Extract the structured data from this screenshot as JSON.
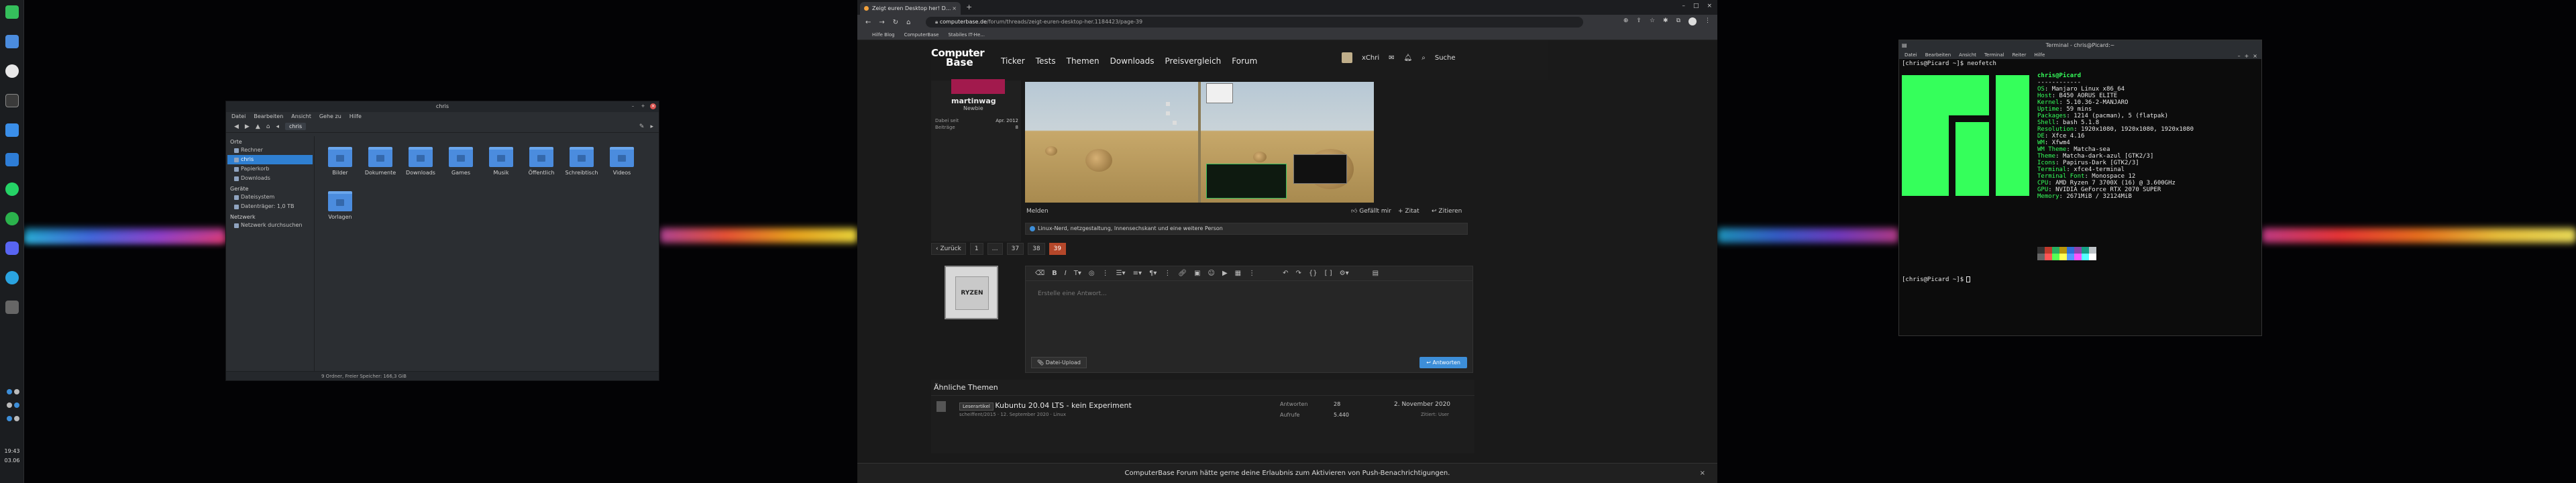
{
  "panel": {
    "clock_time": "19:43",
    "clock_date": "03.06",
    "launcher_icons": [
      "manjaro-icon",
      "files-icon",
      "browser-icon",
      "terminal-icon",
      "mail-icon",
      "office-icon",
      "chat-icon",
      "whatsapp-icon",
      "discord-icon",
      "telegram-icon",
      "settings-icon"
    ]
  },
  "file_manager": {
    "title": "chris",
    "menu": [
      "Datei",
      "Bearbeiten",
      "Ansicht",
      "Gehe zu",
      "Hilfe"
    ],
    "path": "chris",
    "sidebar": {
      "sections": [
        {
          "heading": "Orte",
          "items": [
            "Rechner",
            "chris",
            "Papierkorb",
            "Downloads"
          ]
        },
        {
          "heading": "Geräte",
          "items": [
            "Dateisystem",
            "Datenträger: 1,0 TB"
          ]
        },
        {
          "heading": "Netzwerk",
          "items": [
            "Netzwerk durchsuchen"
          ]
        }
      ],
      "selected": "chris"
    },
    "folders": [
      "Bilder",
      "Dokumente",
      "Downloads",
      "Games",
      "Musik",
      "Öffentlich",
      "Schreibtisch",
      "Videos",
      "Vorlagen"
    ],
    "status": "9 Ordner, Freier Speicher: 166,3 GiB"
  },
  "browser": {
    "tab_title": "Zeigt euren Desktop her! D...",
    "url_domain": "computerbase.de",
    "url_path": "/forum/threads/zeigt-euren-desktop-her.1184423/page-39",
    "bookmarks": [
      "Hilfe Blog",
      "ComputerBase",
      "Stabiles IT-He..."
    ],
    "site": {
      "logo_line1": "Computer",
      "logo_line2": "Base",
      "nav": [
        "Ticker",
        "Tests",
        "Themen",
        "Downloads",
        "Preisvergleich",
        "Forum"
      ],
      "user_name": "xChri",
      "search_label": "Suche"
    },
    "post": {
      "author": "martinwag",
      "rank": "Newbie",
      "joined_label": "Dabei seit",
      "joined_value": "Apr. 2012",
      "posts_label": "Beiträge",
      "posts_value": "8",
      "report_label": "Melden",
      "like_label": "Gefällt mir",
      "quote_label": "Zitat",
      "cite_label": "Zitieren",
      "reactions": "Linux-Nerd, netzgestaltung, Innensechskant und eine weitere Person"
    },
    "pagination": [
      "‹ Zurück",
      "1",
      "…",
      "37",
      "38",
      "39"
    ],
    "current_page": "39",
    "editor": {
      "avatar_text": "RYZEN",
      "placeholder": "Erstelle eine Antwort...",
      "upload_label": "Datei-Upload",
      "send_label": "Antworten"
    },
    "similar": {
      "heading": "Ähnliche Themen",
      "rows": [
        {
          "badge": "Leserartikel",
          "title": "Kubuntu 20.04 LTS - kein Experiment",
          "meta": "scheiffent/2015 · 12. September 2020 · Linux",
          "stat_label": "Antworten",
          "stat_value": "28",
          "date": "2. November 2020",
          "sub_label": "Aufrufe",
          "sub_value": "5.440",
          "last_user": "Zitiert: User"
        }
      ]
    },
    "cookie_banner": "ComputerBase Forum hätte gerne deine Erlaubnis zum Aktivieren von Push-Benachrichtigungen."
  },
  "terminal": {
    "title": "Terminal - chris@Picard:~",
    "menu": [
      "Datei",
      "Bearbeiten",
      "Ansicht",
      "Terminal",
      "Reiter",
      "Hilfe"
    ],
    "prompt1": "[chris@Picard ~]$ neofetch",
    "user_host": "chris@Picard",
    "separator": "------------",
    "info": [
      {
        "k": "OS",
        "v": "Manjaro Linux x86_64"
      },
      {
        "k": "Host",
        "v": "B450 AORUS ELITE"
      },
      {
        "k": "Kernel",
        "v": "5.10.36-2-MANJARO"
      },
      {
        "k": "Uptime",
        "v": "59 mins"
      },
      {
        "k": "Packages",
        "v": "1214 (pacman), 5 (flatpak)"
      },
      {
        "k": "Shell",
        "v": "bash 5.1.8"
      },
      {
        "k": "Resolution",
        "v": "1920x1080, 1920x1080, 1920x1080"
      },
      {
        "k": "DE",
        "v": "Xfce 4.16"
      },
      {
        "k": "WM",
        "v": "Xfwm4"
      },
      {
        "k": "WM Theme",
        "v": "Matcha-sea"
      },
      {
        "k": "Theme",
        "v": "Matcha-dark-azul [GTK2/3]"
      },
      {
        "k": "Icons",
        "v": "Papirus-Dark [GTK2/3]"
      },
      {
        "k": "Terminal",
        "v": "xfce4-terminal"
      },
      {
        "k": "Terminal Font",
        "v": "Monospace 12"
      },
      {
        "k": "CPU",
        "v": "AMD Ryzen 7 3700X (16) @ 3.600GHz"
      },
      {
        "k": "GPU",
        "v": "NVIDIA GeForce RTX 2070 SUPER"
      },
      {
        "k": "Memory",
        "v": "2671MiB / 32124MiB"
      }
    ],
    "prompt2": "[chris@Picard ~]$"
  }
}
